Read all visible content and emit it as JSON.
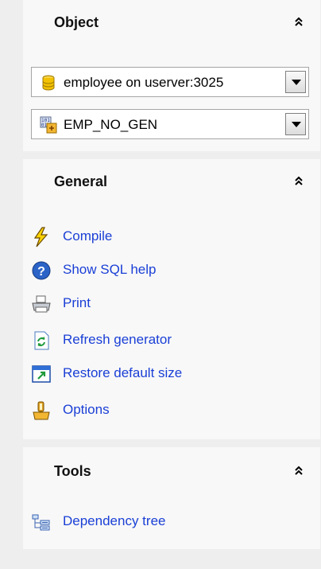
{
  "object_panel": {
    "title": "Object",
    "database_combo": {
      "value": "employee on userver:3025",
      "icon": "database-icon"
    },
    "generator_combo": {
      "value": "EMP_NO_GEN",
      "icon": "generator-icon"
    }
  },
  "general_panel": {
    "title": "General",
    "items": [
      {
        "label": "Compile",
        "icon": "lightning-icon"
      },
      {
        "label": "Show SQL help",
        "icon": "help-icon"
      },
      {
        "label": "Print",
        "icon": "printer-icon"
      },
      {
        "label": "Refresh generator",
        "icon": "refresh-icon"
      },
      {
        "label": "Restore default size",
        "icon": "restore-size-icon"
      },
      {
        "label": "Options",
        "icon": "options-icon"
      }
    ]
  },
  "tools_panel": {
    "title": "Tools",
    "items": [
      {
        "label": "Dependency tree",
        "icon": "dependency-tree-icon"
      }
    ]
  },
  "colors": {
    "link": "#1a3fd6",
    "panel_bg": "#f8f8f8",
    "page_bg": "#eeeeee"
  }
}
